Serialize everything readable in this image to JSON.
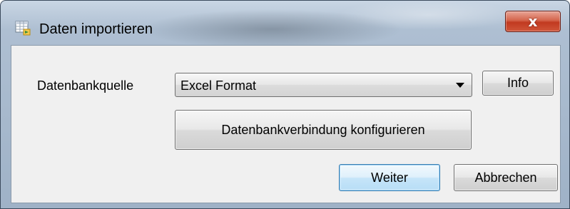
{
  "window": {
    "title": "Daten importieren",
    "close_glyph": "x"
  },
  "form": {
    "source_label": "Datenbankquelle",
    "source_selected": "Excel Format",
    "info_button": "Info",
    "configure_button": "Datenbankverbindung konfigurieren"
  },
  "actions": {
    "next_button": "Weiter",
    "cancel_button": "Abbrechen"
  },
  "icons": {
    "title": "table-import-icon",
    "close": "close-icon",
    "dropdown": "chevron-down-icon"
  },
  "colors": {
    "close_button": "#c9452a",
    "default_button_border": "#3c7fb1",
    "client_background": "#f0f0f0"
  }
}
